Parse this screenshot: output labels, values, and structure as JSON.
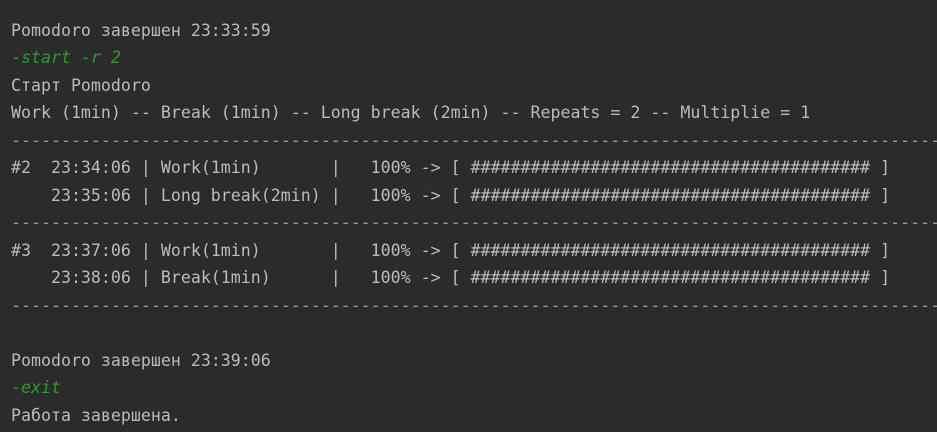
{
  "console": {
    "lines": [
      {
        "text": "Pomodoro завершен 23:33:59",
        "kind": "output"
      },
      {
        "text": "-start -r 2",
        "kind": "command"
      },
      {
        "text": "Старт Pomodoro",
        "kind": "output"
      },
      {
        "text": "Work (1min) -- Break (1min) -- Long break (2min) -- Repeats = 2 -- Multiplie = 1",
        "kind": "output"
      },
      {
        "text": "---------------------------------------------------------------------------------------------",
        "kind": "separator"
      },
      {
        "text": "#2  23:34:06 | Work(1min)       |   100% -> [ ######################################## ]",
        "kind": "progress"
      },
      {
        "text": "    23:35:06 | Long break(2min) |   100% -> [ ######################################## ]",
        "kind": "progress"
      },
      {
        "text": "---------------------------------------------------------------------------------------------",
        "kind": "separator"
      },
      {
        "text": "#3  23:37:06 | Work(1min)       |   100% -> [ ######################################## ]",
        "kind": "progress"
      },
      {
        "text": "    23:38:06 | Break(1min)      |   100% -> [ ######################################## ]",
        "kind": "progress"
      },
      {
        "text": "---------------------------------------------------------------------------------------------",
        "kind": "separator"
      },
      {
        "text": "Pomodoro завершен 23:39:06",
        "kind": "output"
      },
      {
        "text": "-exit",
        "kind": "command"
      },
      {
        "text": "Работа завершена.",
        "kind": "output"
      }
    ]
  },
  "colors": {
    "background": "#2b2b2b",
    "text": "#bbbbbb",
    "command": "#2e9b2e"
  }
}
